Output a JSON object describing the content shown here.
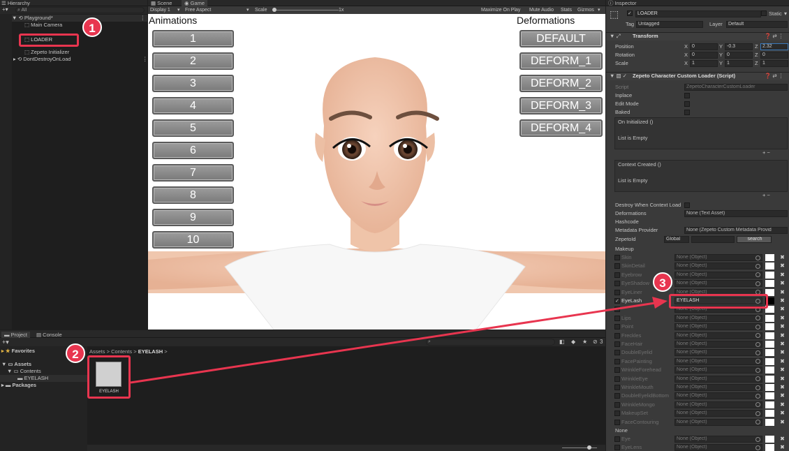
{
  "hierarchy": {
    "title": "Hierarchy",
    "search": "All",
    "items": [
      "Playground*",
      "Main Camera",
      "",
      "LOADER",
      "",
      "Zepeto Initializer",
      "DontDestroyOnLoad"
    ]
  },
  "scene_tab": "Scene",
  "game_tab": "Game",
  "game_toolbar": {
    "display": "Display 1",
    "aspect": "Free Aspect",
    "scale": "Scale",
    "scale_val": "1x",
    "maximize": "Maximize On Play",
    "mute": "Mute Audio",
    "stats": "Stats",
    "gizmos": "Gizmos"
  },
  "game": {
    "anim_title": "Animations",
    "deform_title": "Deformations",
    "anims": [
      "1",
      "2",
      "3",
      "4",
      "5",
      "6",
      "7",
      "8",
      "9",
      "10"
    ],
    "deforms": [
      "DEFAULT",
      "DEFORM_1",
      "DEFORM_2",
      "DEFORM_3",
      "DEFORM_4"
    ]
  },
  "project": {
    "tab": "Project",
    "console": "Console",
    "favorites": "Favorites",
    "assets": "Assets",
    "contents": "Contents",
    "eyelash": "EYELASH",
    "packages": "Packages",
    "breadcrumb": [
      "Assets",
      ">",
      "Contents",
      ">",
      "EYELASH",
      ">"
    ],
    "asset_label": "EYELASH",
    "count": "3"
  },
  "inspector": {
    "title": "Inspector",
    "obj_name": "LOADER",
    "static": "Static",
    "tag_lbl": "Tag",
    "tag": "Untagged",
    "layer_lbl": "Layer",
    "layer": "Default",
    "transform": "Transform",
    "pos": "Position",
    "rot": "Rotation",
    "scale": "Scale",
    "pos_v": [
      "X",
      "0",
      "Y",
      "-0.3",
      "Z",
      "2.32"
    ],
    "rot_v": [
      "X",
      "0",
      "Y",
      "0",
      "Z",
      "0"
    ],
    "scl_v": [
      "X",
      "1",
      "Y",
      "1",
      "Z",
      "1"
    ],
    "script_title": "Zepeto Character Custom Loader (Script)",
    "script_lbl": "Script",
    "script_val": "ZepetoCharacterCustomLoader",
    "inplace": "Inplace",
    "editmode": "Edit Mode",
    "baked": "Baked",
    "oninit": "On Initialized ()",
    "empty1": "List is Empty",
    "ctx": "Context Created ()",
    "empty2": "List is Empty",
    "destroy": "Destroy When Context Load",
    "deform_lbl": "Deformations",
    "deform_val": "None (Text Asset)",
    "hash": "Hashcode",
    "meta_lbl": "Metadata Provider",
    "meta_val": "None (Zepeto Custom Metadata Provid",
    "zid": "ZepetoId",
    "global": "Global",
    "search": "search",
    "makeup": "Makeup",
    "none_hdr": "None",
    "eyelash_lbl": "EyeLash",
    "eyelash_val": "EYELASH",
    "makeup_items": [
      "Skin",
      "SkinDetail",
      "Eyebrow",
      "EyeShadow",
      "EyeLiner",
      "EyeLash",
      "",
      "Lips",
      "Point",
      "Freckles",
      "FaceHair",
      "DoubleEyelid",
      "FacePainting",
      "WrinkleForehead",
      "WrinkleEye",
      "WrinkleMouth",
      "DoubleEyelidBottom",
      "WrinkleMongo",
      "MakeupSet",
      "FaceContouring"
    ],
    "none_items": [
      "Eye",
      "EyeLens"
    ],
    "none_obj": "None (Object)"
  },
  "badges": [
    "1",
    "2",
    "3"
  ],
  "colors": {
    "highlight": "#e8354f",
    "panel": "#282828"
  }
}
